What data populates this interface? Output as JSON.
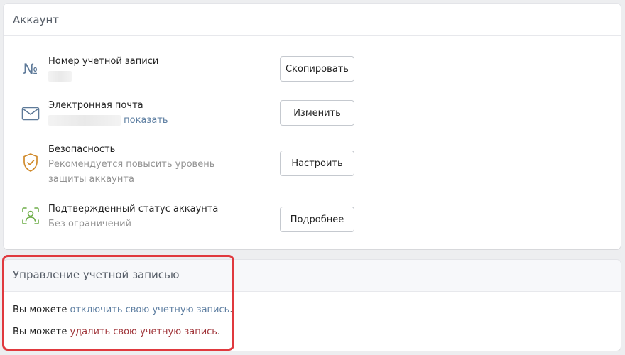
{
  "account": {
    "title": "Аккаунт",
    "items": [
      {
        "icon": "number-sign-icon",
        "title": "Номер учетной записи",
        "button": "Скопировать"
      },
      {
        "icon": "mail-icon",
        "title": "Электронная почта",
        "link": "показать",
        "button": "Изменить"
      },
      {
        "icon": "shield-check-icon",
        "title": "Безопасность",
        "subtitle": "Рекомендуется повысить уровень защиты аккаунта",
        "button": "Настроить"
      },
      {
        "icon": "verified-user-icon",
        "title": "Подтвержденный статус аккаунта",
        "subtitle": "Без ограничений",
        "button": "Подробнее"
      }
    ]
  },
  "manage": {
    "title": "Управление учетной записью",
    "disable_prefix": "Вы можете ",
    "disable_link": "отключить свою учетную запись",
    "disable_suffix": ".",
    "delete_prefix": "Вы можете ",
    "delete_link": "удалить свою учетную запись",
    "delete_suffix": "."
  },
  "colors": {
    "link": "#5d7ea1",
    "danger_link": "#a0353a",
    "highlight": "#e0393e",
    "shield": "#d08a2b",
    "verified": "#6fae4a"
  }
}
